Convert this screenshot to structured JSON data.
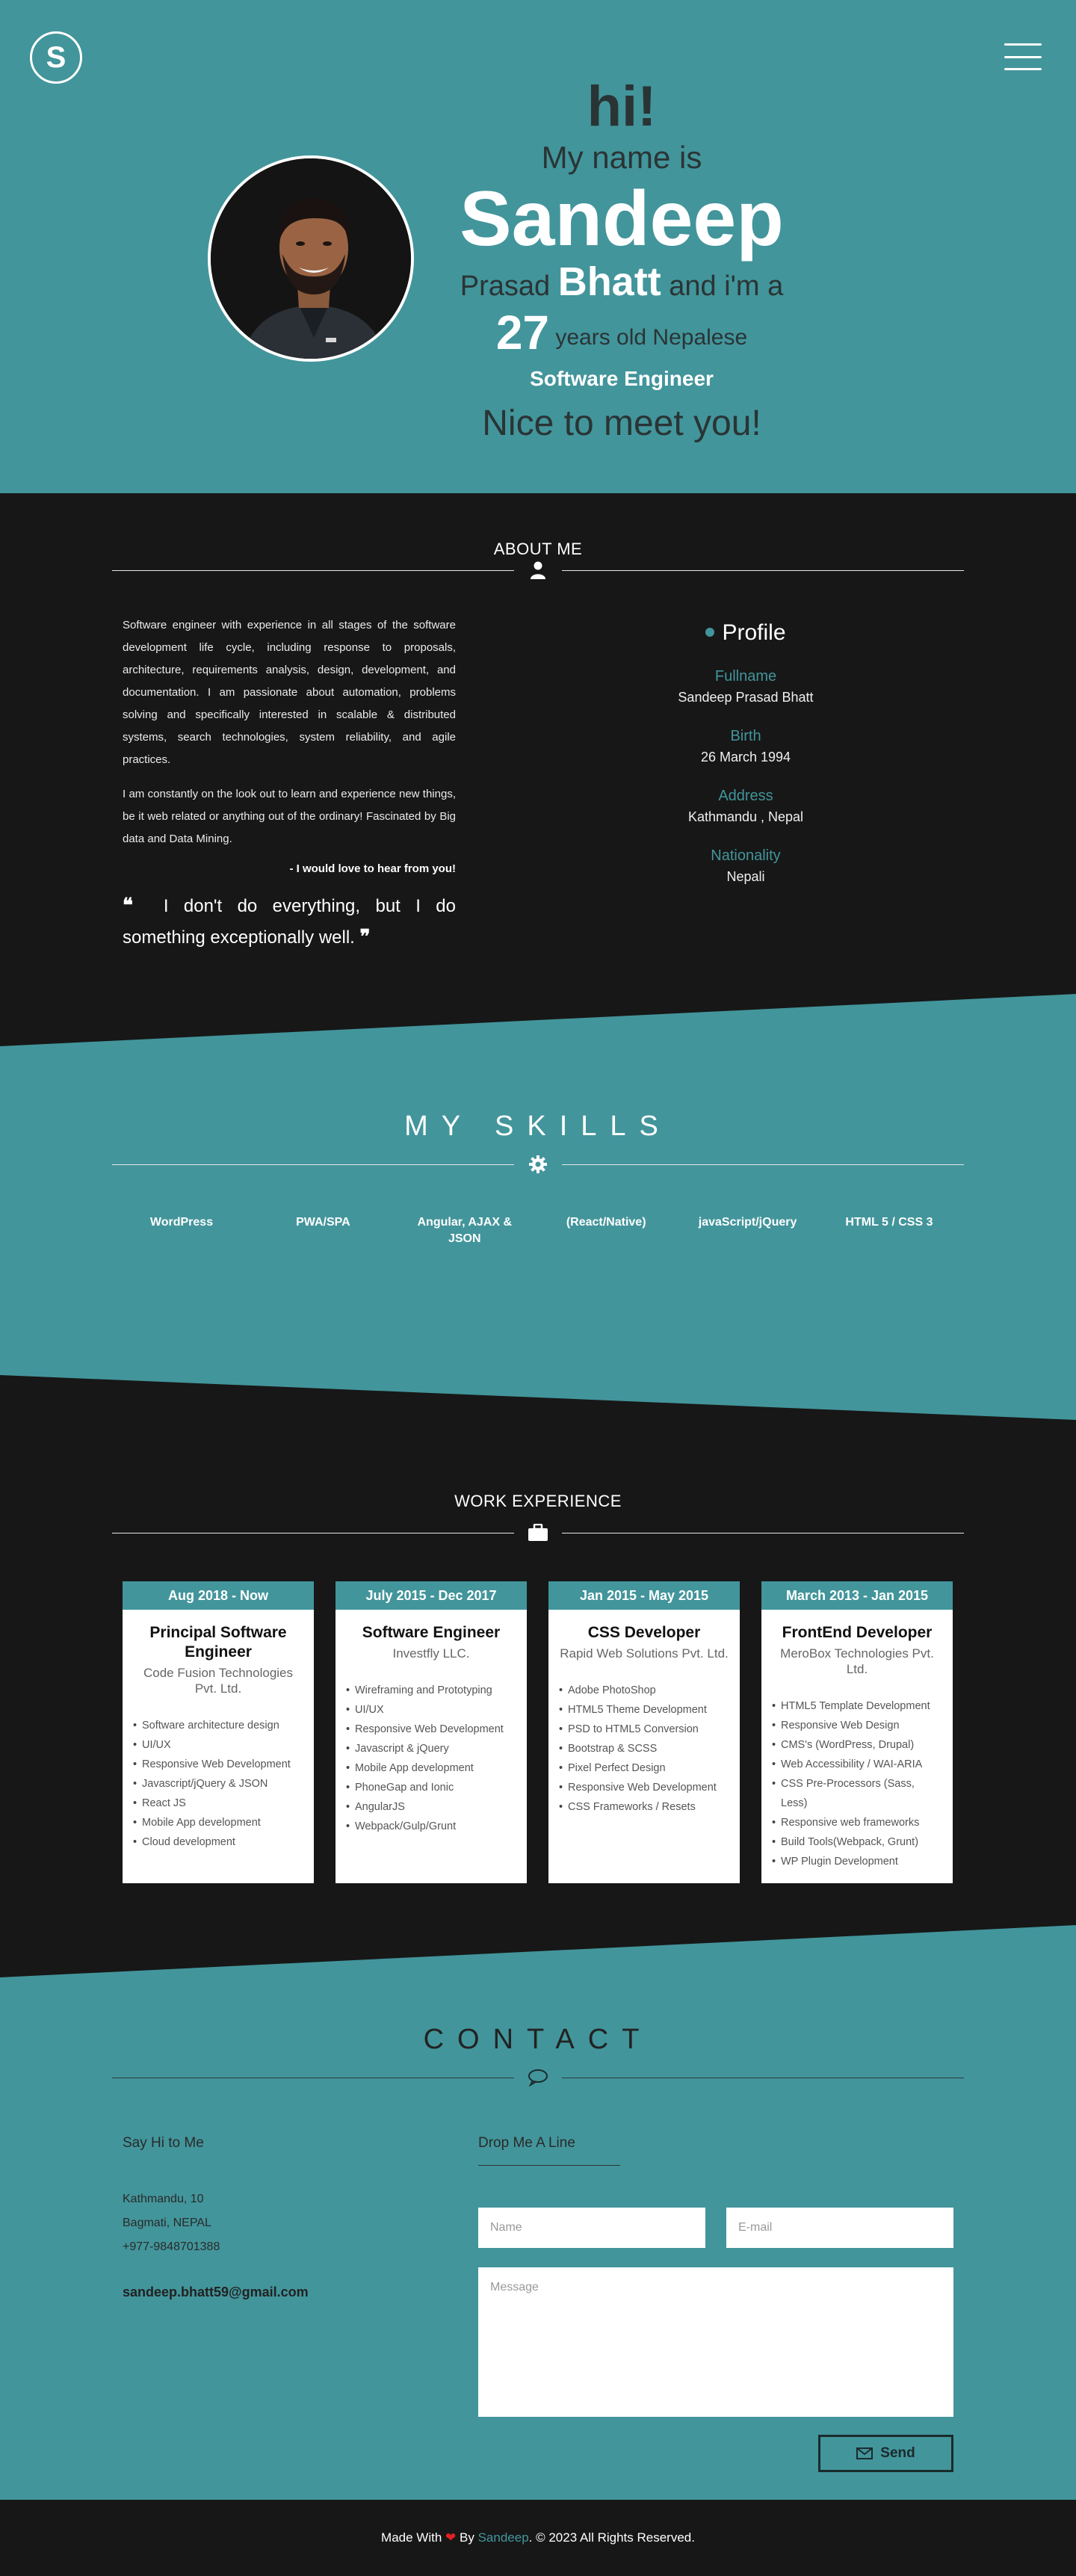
{
  "nav": {
    "logo_letter": "S"
  },
  "hero": {
    "hi": "hi!",
    "my_name_is": "My name is",
    "first_name": "Sandeep",
    "middle_name": "Prasad",
    "last_name": "Bhatt",
    "and_im_a": "and i'm a",
    "age": "27",
    "age_text": "years old Nepalese",
    "role": "Software Engineer",
    "nice": "Nice to meet you!"
  },
  "about": {
    "title": "ABOUT ME",
    "para1": "Software engineer with experience in all stages of the software development life cycle, including response to proposals, architecture, requirements analysis, design, development, and documentation. I am passionate about automation, problems solving and specifically interested in scalable & distributed systems, search technologies, system reliability, and agile practices.",
    "para2": "I am constantly on the look out to learn and experience new things, be it web related or anything out of the ordinary! Fascinated by Big data and Data Mining.",
    "hear": "- I would love to hear from you!",
    "quote": "I don't do everything, but I do something exceptionally well.",
    "profile_title": "Profile",
    "profile": [
      {
        "label": "Fullname",
        "value": "Sandeep Prasad Bhatt"
      },
      {
        "label": "Birth",
        "value": "26 March 1994"
      },
      {
        "label": "Address",
        "value": "Kathmandu , Nepal"
      },
      {
        "label": "Nationality",
        "value": "Nepali"
      }
    ]
  },
  "skills": {
    "title": "MY SKILLS",
    "items": [
      "WordPress",
      "PWA/SPA",
      "Angular, AJAX & JSON",
      "(React/Native)",
      "javaScript/jQuery",
      "HTML 5 / CSS 3"
    ]
  },
  "work": {
    "title": "WORK EXPERIENCE",
    "jobs": [
      {
        "date": "Aug 2018 - Now",
        "title": "Principal Software Engineer",
        "company": "Code Fusion Technologies Pvt. Ltd.",
        "items": [
          "Software architecture design",
          "UI/UX",
          "Responsive Web Development",
          "Javascript/jQuery & JSON",
          "React JS",
          "Mobile App development",
          "Cloud development"
        ]
      },
      {
        "date": "July 2015 - Dec 2017",
        "title": "Software Engineer",
        "company": "Investfly LLC.",
        "items": [
          "Wireframing and Prototyping",
          "UI/UX",
          "Responsive Web Development",
          "Javascript & jQuery",
          "Mobile App development",
          "PhoneGap and Ionic",
          "AngularJS",
          "Webpack/Gulp/Grunt"
        ]
      },
      {
        "date": "Jan 2015 - May 2015",
        "title": "CSS Developer",
        "company": "Rapid Web Solutions Pvt. Ltd.",
        "items": [
          "Adobe PhotoShop",
          "HTML5 Theme Development",
          "PSD to HTML5 Conversion",
          "Bootstrap & SCSS",
          "Pixel Perfect Design",
          "Responsive Web Development",
          "CSS Frameworks / Resets"
        ]
      },
      {
        "date": "March 2013 - Jan 2015",
        "title": "FrontEnd Developer",
        "company": "MeroBox Technologies Pvt. Ltd.",
        "items": [
          "HTML5 Template Development",
          "Responsive Web Design",
          "CMS's (WordPress, Drupal)",
          "Web Accessibility / WAI-ARIA",
          "CSS Pre-Processors (Sass, Less)",
          "Responsive web frameworks",
          "Build Tools(Webpack, Grunt)",
          "WP Plugin Development"
        ]
      }
    ]
  },
  "contact": {
    "title": "CONTACT",
    "say_hi": "Say Hi to Me",
    "address_line1": "Kathmandu, 10",
    "address_line2": "Bagmati, NEPAL",
    "phone": "+977-9848701388",
    "email": "sandeep.bhatt59@gmail.com",
    "drop_line": "Drop Me A Line",
    "name_placeholder": "Name",
    "email_placeholder": "E-mail",
    "message_placeholder": "Message",
    "send_label": "Send"
  },
  "footer": {
    "made_with": "Made With",
    "by": "By",
    "author": "Sandeep",
    "rights": ". © 2023 All Rights Reserved."
  },
  "colors": {
    "accent": "#42959b",
    "dark": "#171717"
  }
}
